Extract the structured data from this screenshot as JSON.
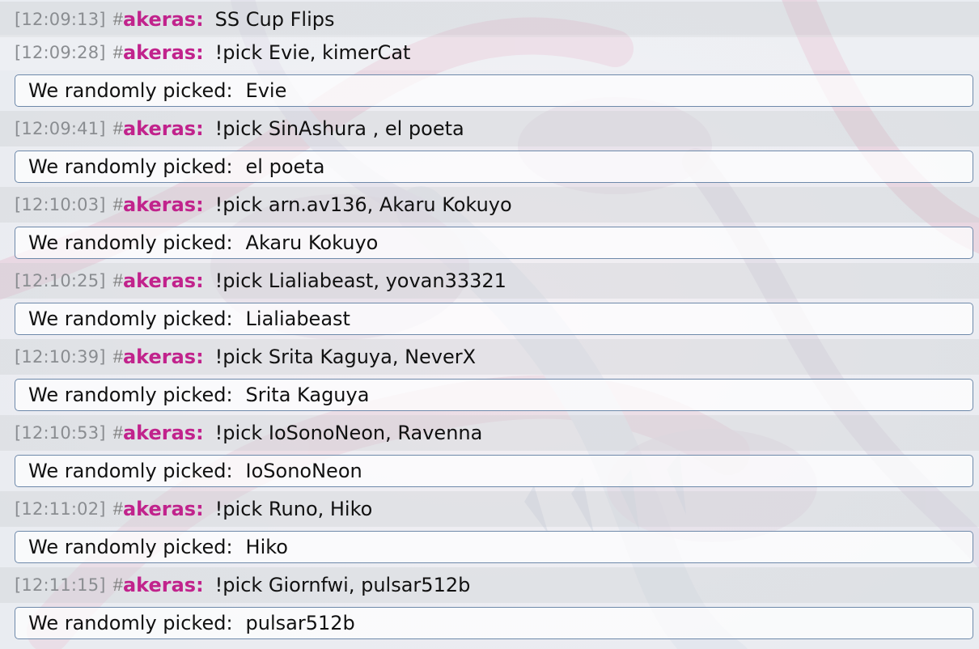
{
  "theme": {
    "username_color": "#c1238c",
    "timestamp_color": "#8a8d91",
    "box_border_color": "#6e89aa",
    "background_art": "faded pokemon artwork (pale pink/lilac swirls)"
  },
  "chat_log": {
    "first_message": {
      "timestamp": "[12:09:13]",
      "hash": "#",
      "user": "akeras",
      "colon": ":",
      "text": "SS Cup Flips"
    },
    "picks": [
      {
        "timestamp": "[12:09:28]",
        "hash": "#",
        "user": "akeras",
        "colon": ":",
        "command": "!pick Evie, kimerCat",
        "result_prefix": "We randomly picked:",
        "result": "Evie"
      },
      {
        "timestamp": "[12:09:41]",
        "hash": "#",
        "user": "akeras",
        "colon": ":",
        "command": "!pick SinAshura , el poeta",
        "result_prefix": "We randomly picked:",
        "result": "el poeta"
      },
      {
        "timestamp": "[12:10:03]",
        "hash": "#",
        "user": "akeras",
        "colon": ":",
        "command": "!pick arn.av136, Akaru Kokuyo",
        "result_prefix": "We randomly picked:",
        "result": "Akaru Kokuyo"
      },
      {
        "timestamp": "[12:10:25]",
        "hash": "#",
        "user": "akeras",
        "colon": ":",
        "command": "!pick Lialiabeast, yovan33321",
        "result_prefix": "We randomly picked:",
        "result": "Lialiabeast"
      },
      {
        "timestamp": "[12:10:39]",
        "hash": "#",
        "user": "akeras",
        "colon": ":",
        "command": "!pick Srita Kaguya, NeverX",
        "result_prefix": "We randomly picked:",
        "result": "Srita Kaguya"
      },
      {
        "timestamp": "[12:10:53]",
        "hash": "#",
        "user": "akeras",
        "colon": ":",
        "command": "!pick IoSonoNeon, Ravenna",
        "result_prefix": "We randomly picked:",
        "result": "IoSonoNeon"
      },
      {
        "timestamp": "[12:11:02]",
        "hash": "#",
        "user": "akeras",
        "colon": ":",
        "command": "!pick Runo, Hiko",
        "result_prefix": "We randomly picked:",
        "result": "Hiko"
      },
      {
        "timestamp": "[12:11:15]",
        "hash": "#",
        "user": "akeras",
        "colon": ":",
        "command": "!pick Giornfwi, pulsar512b",
        "result_prefix": "We randomly picked:",
        "result": "pulsar512b"
      }
    ]
  }
}
